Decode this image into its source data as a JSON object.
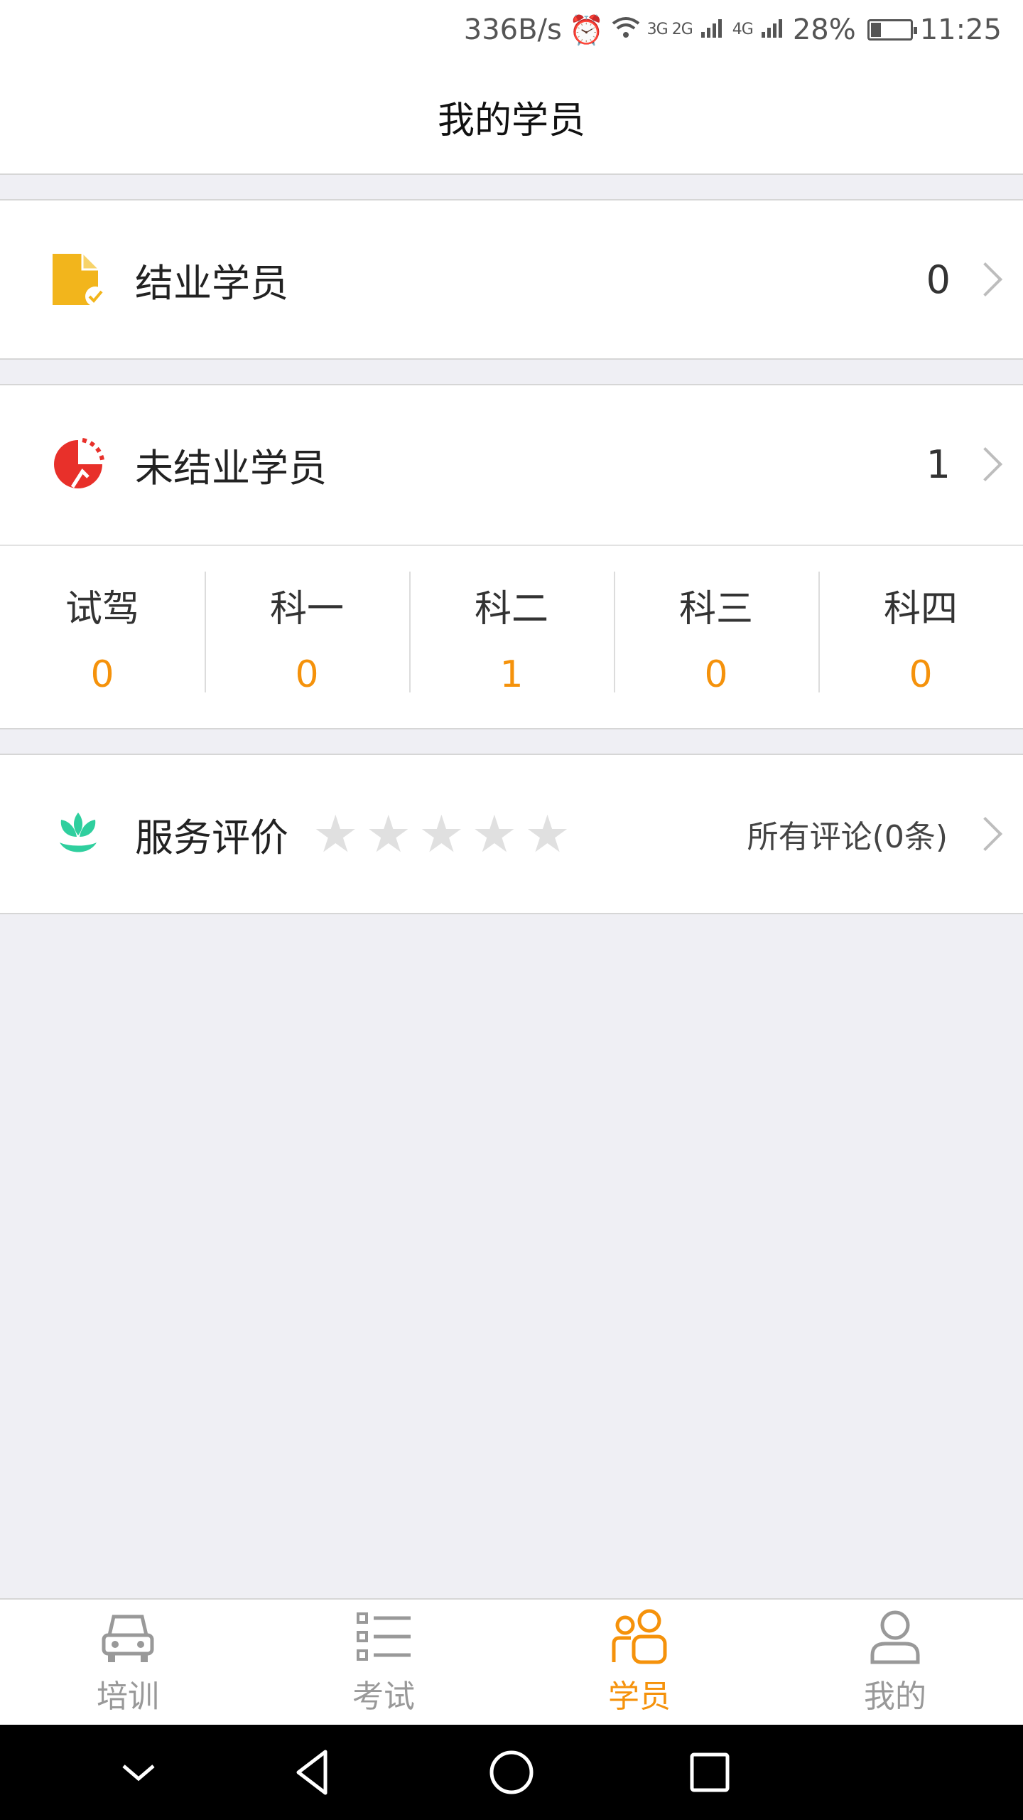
{
  "status_bar": {
    "net_speed": "336B/s",
    "signal_a": "3G 2G",
    "signal_b": "4G",
    "battery": "28%",
    "time": "11:25"
  },
  "header": {
    "title": "我的学员"
  },
  "graduated": {
    "label": "结业学员",
    "count": "0",
    "icon": "document-check-icon"
  },
  "ungraduated": {
    "label": "未结业学员",
    "count": "1",
    "icon": "progress-pie-icon"
  },
  "subjects": [
    {
      "name": "试驾",
      "count": "0"
    },
    {
      "name": "科一",
      "count": "0"
    },
    {
      "name": "科二",
      "count": "1"
    },
    {
      "name": "科三",
      "count": "0"
    },
    {
      "name": "科四",
      "count": "0"
    }
  ],
  "service": {
    "label": "服务评价",
    "rating": 0,
    "max_rating": 5,
    "reviews_link": "所有评论(0条)",
    "icon": "lotus-icon"
  },
  "tabbar": {
    "active": 2,
    "items": [
      {
        "label": "培训",
        "icon": "car-icon"
      },
      {
        "label": "考试",
        "icon": "list-icon"
      },
      {
        "label": "学员",
        "icon": "students-icon"
      },
      {
        "label": "我的",
        "icon": "user-icon"
      }
    ]
  },
  "colors": {
    "accent": "#f5920b",
    "star_empty": "#e0e0e0",
    "doc_icon": "#f2b51c",
    "pie_icon": "#e8302a",
    "lotus_icon": "#2fcf9e"
  }
}
